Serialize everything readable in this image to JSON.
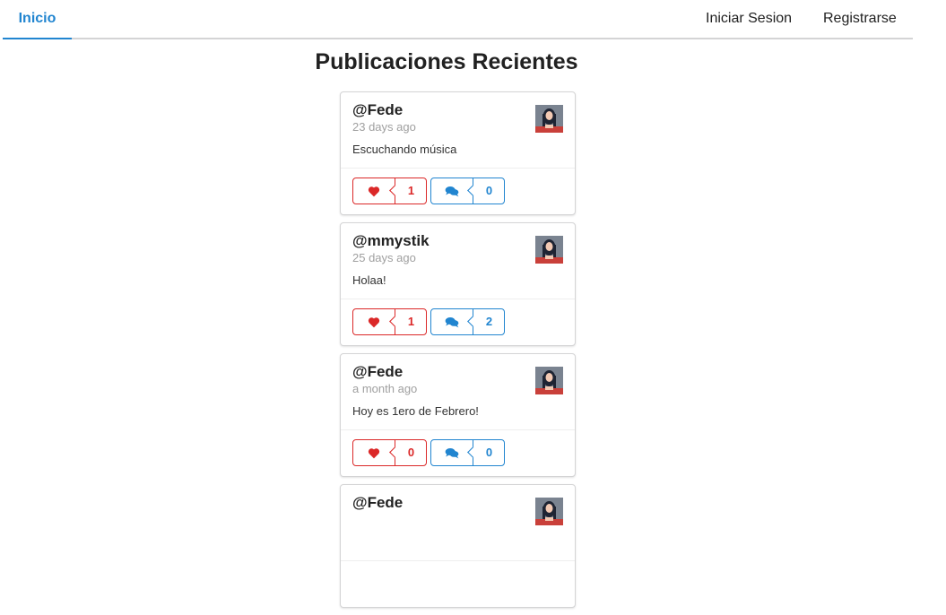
{
  "nav": {
    "home_label": "Inicio",
    "login_label": "Iniciar Sesion",
    "register_label": "Registrarse"
  },
  "page_title": "Publicaciones Recientes",
  "colors": {
    "accent": "#2185d0",
    "like": "#db2828",
    "comment": "#2185d0"
  },
  "posts": [
    {
      "user": "@Fede",
      "time": "23 days ago",
      "body": "Escuchando música",
      "likes": "1",
      "comments": "0"
    },
    {
      "user": "@mmystik",
      "time": "25 days ago",
      "body": "Holaa!",
      "likes": "1",
      "comments": "2"
    },
    {
      "user": "@Fede",
      "time": "a month ago",
      "body": "Hoy es 1ero de Febrero!",
      "likes": "0",
      "comments": "0"
    },
    {
      "user": "@Fede"
    }
  ]
}
